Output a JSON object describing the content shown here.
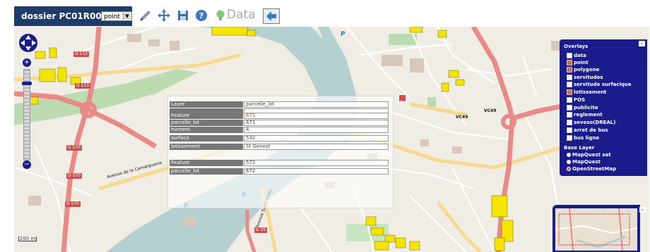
{
  "toolbar": {
    "dossier_label": "dossier PC01R002101",
    "mode_value": "point",
    "data_label": "Data",
    "icons": [
      "pen-icon",
      "move-icon",
      "save-icon",
      "help-icon",
      "bulb-icon",
      "back-arrow-icon"
    ]
  },
  "map": {
    "road_labels": [
      "D 113",
      "D 113",
      "D 570",
      "D 570",
      "D 570",
      "D 570",
      "VC49",
      "VC49",
      "D 35"
    ],
    "street_labels": [
      "Avenue de la Camarguaise",
      "Avenue Saint Gilles"
    ],
    "scale_label": "200 m",
    "parking_label": "P"
  },
  "popup": {
    "rows": [
      {
        "key": "Layer",
        "value": "parcelle_lot"
      },
      {
        "key": "",
        "value": ""
      },
      {
        "key": "Feature",
        "value": "671"
      },
      {
        "key": "parcelle_lot",
        "value": "671"
      },
      {
        "key": "numero",
        "value": "4"
      },
      {
        "key": "surface",
        "value": "532"
      },
      {
        "key": "lotissement",
        "value": "St Genest"
      },
      {
        "key": "",
        "value": ""
      },
      {
        "key": "Feature",
        "value": "572"
      },
      {
        "key": "parcelle_lot",
        "value": "672"
      }
    ]
  },
  "layer_switcher": {
    "overlays_title": "Overlays",
    "overlays": [
      {
        "label": "data",
        "checked": false
      },
      {
        "label": "point",
        "checked": true
      },
      {
        "label": "polygone",
        "checked": true
      },
      {
        "label": "servitudes",
        "checked": false
      },
      {
        "label": "servitude surfacique",
        "checked": false
      },
      {
        "label": "lotissement",
        "checked": true
      },
      {
        "label": "POS",
        "checked": false
      },
      {
        "label": "publicite",
        "checked": false
      },
      {
        "label": "reglement",
        "checked": false
      },
      {
        "label": "seveso(DREAL)",
        "checked": false
      },
      {
        "label": "arret de bus",
        "checked": false
      },
      {
        "label": "bus ligne",
        "checked": false
      }
    ],
    "base_title": "Base Layer",
    "base_layers": [
      {
        "label": "MapQuest sat",
        "selected": false
      },
      {
        "label": "MapQuest",
        "selected": false
      },
      {
        "label": "OpenStreetMap",
        "selected": true
      }
    ],
    "minimize_label": "-"
  },
  "colors": {
    "panel_blue": "#1a1c8c",
    "dossier_bg": "#1d3c69",
    "major_road": "#e98a86",
    "secondary_road": "#f8d98f",
    "water": "#b5d0d0",
    "green": "#bcdbb0",
    "parcel": "#f5e400"
  }
}
